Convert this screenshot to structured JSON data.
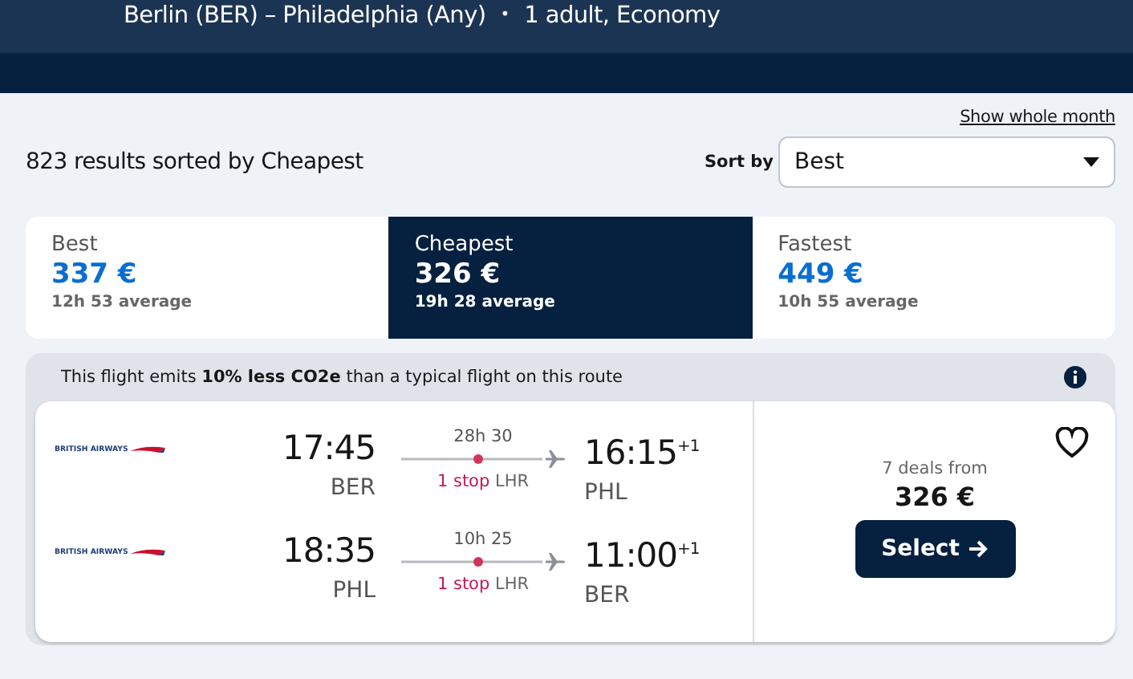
{
  "header": {
    "route": "Berlin (BER) – Philadelphia (Any)",
    "separator": "•",
    "travellers": "1 adult, Economy"
  },
  "show_month_link": "Show whole month",
  "results_summary": "823 results sorted by Cheapest",
  "sort": {
    "label": "Sort by",
    "value": "Best"
  },
  "tabs": [
    {
      "label": "Best",
      "price": "337 €",
      "average": "12h 53 average",
      "selected": false
    },
    {
      "label": "Cheapest",
      "price": "326 €",
      "average": "19h 28 average",
      "selected": true
    },
    {
      "label": "Fastest",
      "price": "449 €",
      "average": "10h 55 average",
      "selected": false
    }
  ],
  "result": {
    "eco_message": "This flight emits **10% less CO2e** than a typical flight on this route",
    "legs": [
      {
        "airline": "BRITISH AIRWAYS",
        "depart": "17:45",
        "from": "BER",
        "duration": "28h 30",
        "stops": "1 stop",
        "via": "LHR",
        "arrive": "16:15",
        "day_offset": "+1",
        "to": "PHL"
      },
      {
        "airline": "BRITISH AIRWAYS",
        "depart": "18:35",
        "from": "PHL",
        "duration": "10h 25",
        "stops": "1 stop",
        "via": "LHR",
        "arrive": "11:00",
        "day_offset": "+1",
        "to": "BER"
      }
    ],
    "deals": "7 deals from",
    "price": "326 €",
    "button": "Select",
    "saved": false
  }
}
